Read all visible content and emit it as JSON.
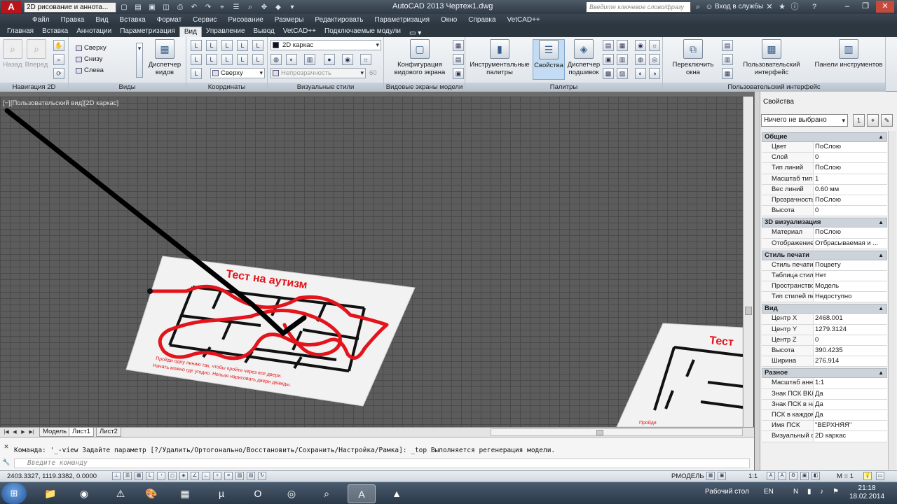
{
  "titlebar": {
    "app_logo": "A",
    "workspace": "2D рисование и аннота...",
    "title": "AutoCAD 2013    Чертеж1.dwg",
    "search_placeholder": "Введите ключевое слово/фразу",
    "signin": "Вход в службы",
    "help": "?"
  },
  "menubar": [
    "Файл",
    "Правка",
    "Вид",
    "Вставка",
    "Формат",
    "Сервис",
    "Рисование",
    "Размеры",
    "Редактировать",
    "Параметризация",
    "Окно",
    "Справка",
    "VetCAD++"
  ],
  "ribbon_tabs": [
    "Главная",
    "Вставка",
    "Аннотации",
    "Параметризация",
    "Вид",
    "Управление",
    "Вывод",
    "VetCAD++",
    "Подключаемые модули"
  ],
  "ribbon": {
    "nav2d": {
      "back": "Назад",
      "forward": "Вперед",
      "title": "Навигация 2D"
    },
    "views": {
      "items": [
        "Сверху",
        "Снизу",
        "Слева"
      ],
      "manager": "Диспетчер видов",
      "title": "Виды"
    },
    "coords": {
      "combo": "Сверху",
      "title": "Координаты"
    },
    "visual": {
      "style": "2D каркас",
      "transparency": "Непрозрачность",
      "transparency_value": "60",
      "title": "Визуальные стили"
    },
    "viewports": {
      "config": "Конфигурация видового экрана",
      "title": "Видовые экраны модели"
    },
    "palettes": {
      "tool": "Инструментальные палитры",
      "properties": "Свойства",
      "sheetset": "Диспетчер подшивок",
      "title": "Палитры"
    },
    "ui": {
      "switch": "Переключить окна",
      "custom": "Пользовательский интерфейс",
      "toolbars": "Панели инструментов",
      "title": "Пользовательский интерфейс"
    }
  },
  "viewport": {
    "label": "[−][Пользовательский вид][2D каркас]",
    "sheet1_title": "Тест на аутизм",
    "sheet1_line1": "Пройди одну линию так, чтобы пройти через все двери.",
    "sheet1_line2": "Начать можно где угодно. Нельзя нарисовать двери дважды.",
    "sheet2_title": "Тест",
    "sheet2_line1": "Пройди",
    "accent_red": "#e3141b"
  },
  "layout_tabs": [
    "Модель",
    "Лист1",
    "Лист2"
  ],
  "command": {
    "history": "Команда: '_-view Задайте параметр [?/Удалить/Ортогонально/Восстановить/Сохранить/Настройка/Рамка]: _top Выполняется регенерация модели.",
    "placeholder": "Введите команду"
  },
  "properties": {
    "header": "Свойства",
    "selection": "Ничего не выбрано",
    "categories": [
      {
        "name": "Общие",
        "rows": [
          [
            "Цвет",
            "ПоСлою"
          ],
          [
            "Слой",
            "0"
          ],
          [
            "Тип линий",
            "ПоСлою"
          ],
          [
            "Масштаб тип...",
            "1"
          ],
          [
            "Вес линий",
            "0.60 мм"
          ],
          [
            "Прозрачность",
            "ПоСлою"
          ],
          [
            "Высота",
            "0"
          ]
        ]
      },
      {
        "name": "3D визуализация",
        "rows": [
          [
            "Материал",
            "ПоСлою"
          ],
          [
            "Отображение ...",
            "Отбрасываемая и ..."
          ]
        ]
      },
      {
        "name": "Стиль печати",
        "rows": [
          [
            "Стиль печати",
            "Поцвету"
          ],
          [
            "Таблица стил...",
            "Нет"
          ],
          [
            "Пространство...",
            "Модель"
          ],
          [
            "Тип стилей пе...",
            "Недоступно"
          ]
        ]
      },
      {
        "name": "Вид",
        "rows": [
          [
            "Центр X",
            "2468.001"
          ],
          [
            "Центр Y",
            "1279.3124"
          ],
          [
            "Центр Z",
            "0"
          ],
          [
            "Высота",
            "390.4235"
          ],
          [
            "Ширина",
            "276.914"
          ]
        ]
      },
      {
        "name": "Разное",
        "rows": [
          [
            "Масштаб анн...",
            "1:1"
          ],
          [
            "Знак ПСК ВКЛ",
            "Да"
          ],
          [
            "Знак ПСК в на...",
            "Да"
          ],
          [
            "ПСК в каждом...",
            "Да"
          ],
          [
            "Имя ПСК",
            "\"ВЕРХНЯЯ\""
          ],
          [
            "Визуальный с...",
            "2D каркас"
          ]
        ]
      }
    ]
  },
  "status": {
    "coords": "2403.3327, 1119.3382, 0.0000",
    "model": "РМОДЕЛЬ",
    "scale": "1:1",
    "m": "M = 1"
  },
  "taskbar": {
    "desktop": "Рабочий стол",
    "lang": "EN",
    "time": "21:18",
    "date": "18.02.2014"
  }
}
